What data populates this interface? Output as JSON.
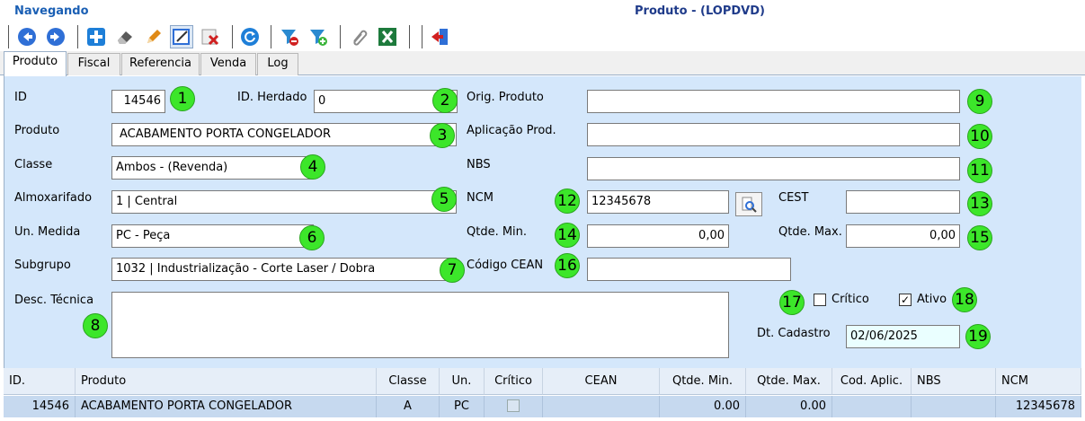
{
  "header": {
    "mode": "Navegando",
    "title": "Produto - (LOPDVD)"
  },
  "toolbar": {
    "buttons": [
      {
        "icon": "arrow-left-icon",
        "color": "#2f6fd6"
      },
      {
        "icon": "arrow-right-icon",
        "color": "#2f6fd6"
      },
      {
        "icon": "add-icon",
        "color": "#1e7fd8"
      },
      {
        "icon": "eraser-icon",
        "color": "#4a4a4a"
      },
      {
        "icon": "edit-pencil-icon",
        "color": "#e08a16"
      },
      {
        "icon": "edit-form-icon",
        "color": "#2f6fd6"
      },
      {
        "icon": "delete-icon",
        "color": "#d02020"
      },
      {
        "icon": "refresh-icon",
        "color": "#1e7fd8"
      },
      {
        "icon": "filter-remove-icon",
        "color": "#2a8ad0"
      },
      {
        "icon": "filter-add-icon",
        "color": "#2a8ad0"
      },
      {
        "icon": "attach-icon",
        "color": "#8a8a8a"
      },
      {
        "icon": "excel-icon",
        "color": "#1d7a3c"
      },
      {
        "icon": "exit-icon",
        "color": "#d02020"
      }
    ]
  },
  "tabs": [
    "Produto",
    "Fiscal",
    "Referencia",
    "Venda",
    "Log"
  ],
  "form": {
    "id": {
      "label": "ID",
      "value": "14546"
    },
    "id_herdado": {
      "label": "ID. Herdado",
      "value": "0"
    },
    "produto": {
      "label": "Produto",
      "value": "ACABAMENTO  PORTA CONGELADOR"
    },
    "classe": {
      "label": "Classe",
      "value": "Ambos - (Revenda)"
    },
    "almoxarifado": {
      "label": "Almoxarifado",
      "value": "1 | Central"
    },
    "un_medida": {
      "label": "Un. Medida",
      "value": "PC - Peça"
    },
    "subgrupo": {
      "label": "Subgrupo",
      "value": "1032 | Industrialização - Corte Laser / Dobra"
    },
    "desc_tecnica": {
      "label": "Desc. Técnica",
      "value": ""
    },
    "orig_produto": {
      "label": "Orig. Produto",
      "value": ""
    },
    "aplicacao_prod": {
      "label": "Aplicação Prod.",
      "value": ""
    },
    "nbs": {
      "label": "NBS",
      "value": ""
    },
    "ncm": {
      "label": "NCM",
      "value": "12345678"
    },
    "cest": {
      "label": "CEST",
      "value": ""
    },
    "qtde_min": {
      "label": "Qtde. Min.",
      "value": "0,00"
    },
    "qtde_max": {
      "label": "Qtde. Max.",
      "value": "0,00"
    },
    "codigo_cean": {
      "label": "Código CEAN",
      "value": ""
    },
    "critico": {
      "label": "Crítico",
      "checked": false
    },
    "ativo": {
      "label": "Ativo",
      "checked": true
    },
    "dt_cadastro": {
      "label": "Dt. Cadastro",
      "value": "02/06/2025"
    }
  },
  "badges": [
    "1",
    "2",
    "3",
    "4",
    "5",
    "6",
    "7",
    "8",
    "9",
    "10",
    "11",
    "12",
    "13",
    "14",
    "15",
    "16",
    "17",
    "18",
    "19"
  ],
  "grid": {
    "columns": [
      "ID.",
      "Produto",
      "Classe",
      "Un.",
      "Crítico",
      "CEAN",
      "Qtde. Min.",
      "Qtde. Max.",
      "Cod. Aplic.",
      "NBS",
      "NCM"
    ],
    "rows": [
      [
        "14546",
        "ACABAMENTO PORTA CONGELADOR",
        "A",
        "PC",
        "",
        "",
        "0.00",
        "0.00",
        "",
        "",
        "12345678"
      ]
    ]
  },
  "colors": {
    "panel": "#d4e7fb",
    "badge": "#3ce62a",
    "selected_row": "#c6d9ef"
  }
}
